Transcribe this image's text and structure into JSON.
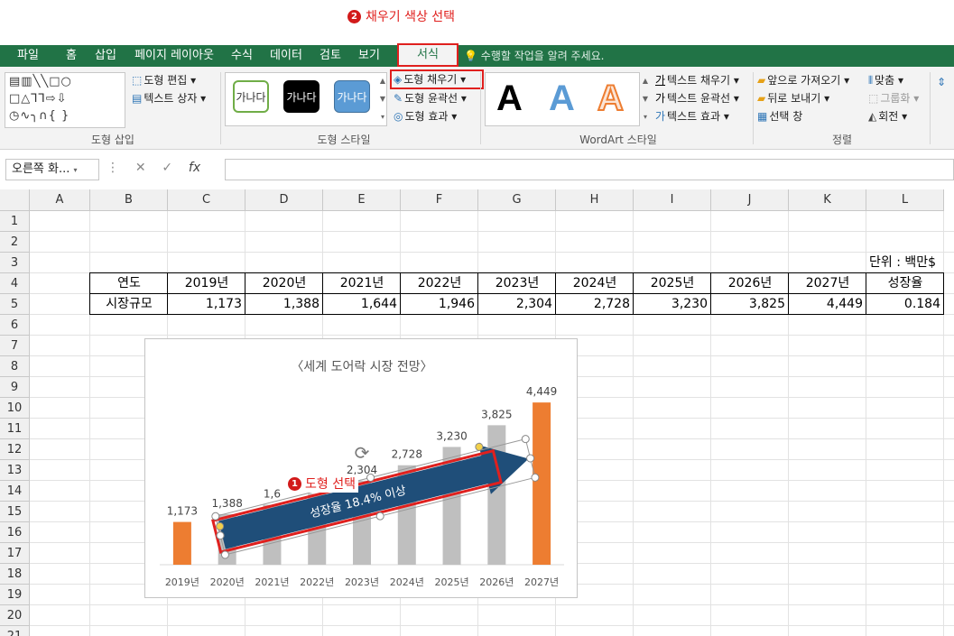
{
  "annotations": {
    "step1_num": "1",
    "step1_label": "도형 선택",
    "step2_num": "2",
    "step2_label": "채우기 색상 선택",
    "accent": "#e0201e"
  },
  "ribbon": {
    "tabs": [
      "파일",
      "홈",
      "삽입",
      "페이지 레이아웃",
      "수식",
      "데이터",
      "검토",
      "보기",
      "서식"
    ],
    "active_tab": "서식",
    "tell_me": "수행할 작업을 알려 주세요.",
    "insert_shapes": {
      "edit_shape": "도형 편집",
      "text_box": "텍스트 상자",
      "group_label": "도형 삽입"
    },
    "shape_styles": {
      "swatch_text": "가나다",
      "fill": "도형 채우기",
      "outline": "도형 윤곽선",
      "effects": "도형 효과",
      "group_label": "도형 스타일"
    },
    "wordart": {
      "glyph": "A",
      "text_fill": "텍스트 채우기",
      "text_outline": "텍스트 윤곽선",
      "text_effects": "텍스트 효과",
      "group_label": "WordArt 스타일"
    },
    "arrange": {
      "bring_forward": "앞으로 가져오기",
      "send_backward": "뒤로 보내기",
      "selection_pane": "선택 창",
      "align": "맞춤",
      "group": "그룹화",
      "rotate": "회전",
      "group_label": "정렬"
    },
    "brand_color": "#217346"
  },
  "formula_bar": {
    "name_box": "오른쪽 화...",
    "fx": "fx",
    "formula": ""
  },
  "sheet": {
    "columns": [
      "A",
      "B",
      "C",
      "D",
      "E",
      "F",
      "G",
      "H",
      "I",
      "J",
      "K",
      "L"
    ],
    "rows": [
      "1",
      "2",
      "3",
      "4",
      "5",
      "6",
      "7",
      "8",
      "9",
      "10",
      "11",
      "12",
      "13",
      "14",
      "15",
      "16",
      "17",
      "18",
      "19",
      "20",
      "21"
    ],
    "unit_label": "단위 : 백만$",
    "table": {
      "headers": [
        "연도",
        "2019년",
        "2020년",
        "2021년",
        "2022년",
        "2023년",
        "2024년",
        "2025년",
        "2026년",
        "2027년",
        "성장율"
      ],
      "row_label": "시장규모",
      "values": [
        "1,173",
        "1,388",
        "1,644",
        "1,946",
        "2,304",
        "2,728",
        "3,230",
        "3,825",
        "4,449",
        "0.184"
      ]
    }
  },
  "chart_data": {
    "type": "bar",
    "title": "〈세계 도어락 시장 전망〉",
    "categories": [
      "2019년",
      "2020년",
      "2021년",
      "2022년",
      "2023년",
      "2024년",
      "2025년",
      "2026년",
      "2027년"
    ],
    "values": [
      1173,
      1388,
      1644,
      1946,
      2304,
      2728,
      3230,
      3825,
      4449
    ],
    "data_labels": [
      "1,173",
      "1,388",
      "1,6",
      "",
      "2,304",
      "2,728",
      "3,230",
      "3,825",
      "4,449"
    ],
    "bar_colors": [
      "#ed7d31",
      "#bfbfbf",
      "#bfbfbf",
      "#bfbfbf",
      "#bfbfbf",
      "#bfbfbf",
      "#bfbfbf",
      "#bfbfbf",
      "#ed7d31"
    ],
    "ylim": [
      0,
      4700
    ],
    "arrow_text": "성장율 18.4% 이상",
    "arrow_color": "#1f4e79"
  }
}
